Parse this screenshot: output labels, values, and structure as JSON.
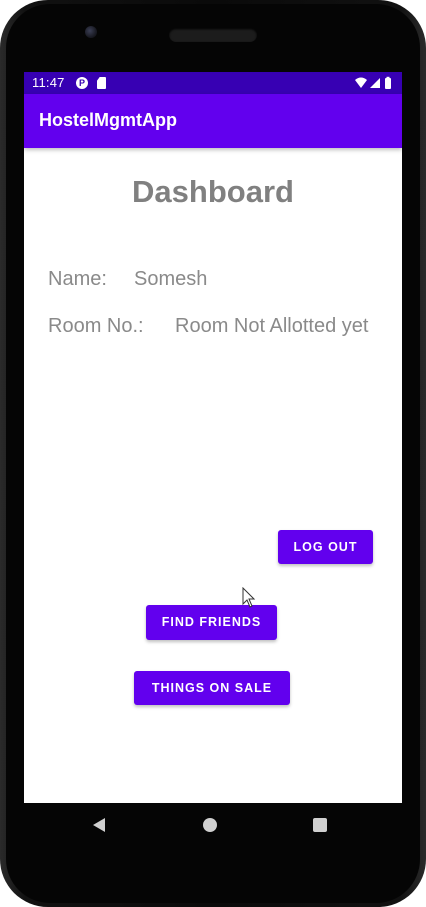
{
  "status_bar": {
    "time": "11:47",
    "notification_icons": [
      "p-icon",
      "sd-card-icon"
    ],
    "system_icons": [
      "wifi-icon",
      "signal-icon",
      "battery-icon"
    ]
  },
  "app_bar": {
    "title": "HostelMgmtApp"
  },
  "dashboard": {
    "title": "Dashboard",
    "name_label": "Name:",
    "name_value": "Somesh",
    "room_label": "Room No.:",
    "room_value": "Room Not Allotted yet"
  },
  "buttons": {
    "logout": "LOG OUT",
    "find_friends": "FIND FRIENDS",
    "things_on_sale": "THINGS ON SALE"
  },
  "nav_bar": {
    "icons": [
      "back-icon",
      "home-icon",
      "recents-icon"
    ]
  },
  "colors": {
    "status_bar": "#3700b3",
    "primary": "#6200ee",
    "text_gray": "#808080"
  }
}
